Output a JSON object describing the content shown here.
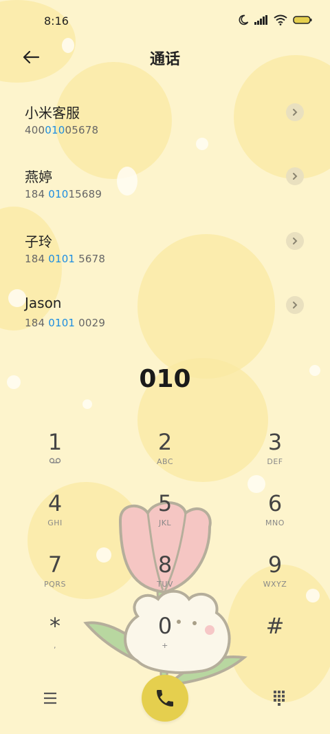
{
  "status": {
    "time": "8:16"
  },
  "header": {
    "title": "通话"
  },
  "contacts": [
    {
      "name": "小米客服",
      "num_pre": "400",
      "num_hl": "010",
      "num_post": "05678"
    },
    {
      "name": "燕婷",
      "num_pre": "184 ",
      "num_hl": "010",
      "num_post": "15689"
    },
    {
      "name": "子玲",
      "num_pre": "184 ",
      "num_hl": "0101",
      "num_post": " 5678"
    },
    {
      "name": "Jason",
      "num_pre": "184 ",
      "num_hl": "0101",
      "num_post": " 0029"
    }
  ],
  "dial": {
    "input": "010"
  },
  "keypad": [
    {
      "digit": "1",
      "letters": ""
    },
    {
      "digit": "2",
      "letters": "ABC"
    },
    {
      "digit": "3",
      "letters": "DEF"
    },
    {
      "digit": "4",
      "letters": "GHI"
    },
    {
      "digit": "5",
      "letters": "JKL"
    },
    {
      "digit": "6",
      "letters": "MNO"
    },
    {
      "digit": "7",
      "letters": "PQRS"
    },
    {
      "digit": "8",
      "letters": "TUV"
    },
    {
      "digit": "9",
      "letters": "WXYZ"
    },
    {
      "digit": "*",
      "letters": ","
    },
    {
      "digit": "0",
      "letters": "+"
    },
    {
      "digit": "#",
      "letters": ""
    }
  ],
  "icons": {
    "back": "arrow-left-icon",
    "chevron": "chevron-right-icon",
    "voicemail": "voicemail-icon",
    "menu": "menu-icon",
    "call": "phone-icon",
    "keypad": "dialpad-icon"
  },
  "colors": {
    "background": "#fdf4cc",
    "highlight": "#1c8de0",
    "call_button": "#e5cf4e"
  }
}
